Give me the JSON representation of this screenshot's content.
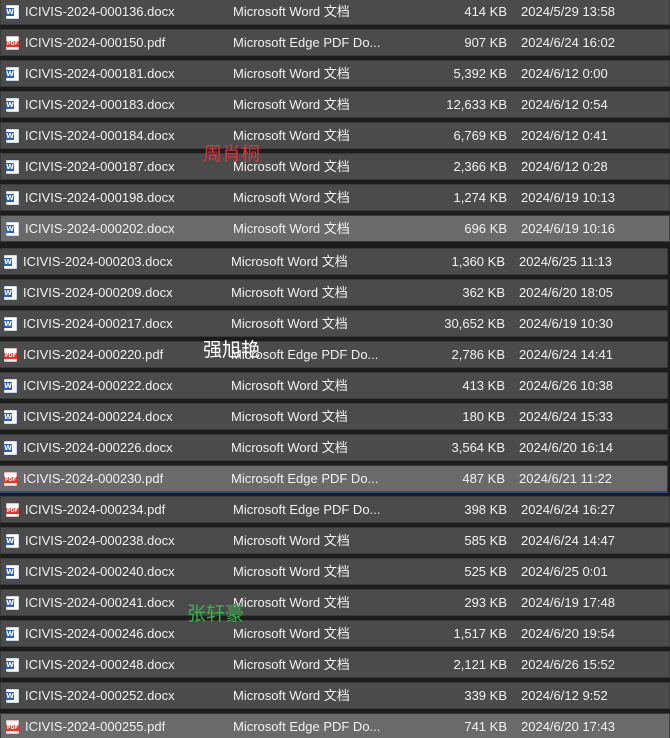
{
  "files": [
    {
      "name": "ICIVIS-2024-000136.docx",
      "type": "Microsoft Word 文档",
      "size": "414 KB",
      "date": "2024/5/29 13:58",
      "icon": "word-document-icon"
    },
    {
      "name": "ICIVIS-2024-000150.pdf",
      "type": "Microsoft Edge PDF Do...",
      "size": "907 KB",
      "date": "2024/6/24 16:02",
      "icon": "pdf-document-icon"
    },
    {
      "name": "ICIVIS-2024-000181.docx",
      "type": "Microsoft Word 文档",
      "size": "5,392 KB",
      "date": "2024/6/12 0:00",
      "icon": "word-document-icon"
    },
    {
      "name": "ICIVIS-2024-000183.docx",
      "type": "Microsoft Word 文档",
      "size": "12,633 KB",
      "date": "2024/6/12 0:54",
      "icon": "word-document-icon"
    },
    {
      "name": "ICIVIS-2024-000184.docx",
      "type": "Microsoft Word 文档",
      "size": "6,769 KB",
      "date": "2024/6/12 0:41",
      "icon": "word-document-icon"
    },
    {
      "name": "ICIVIS-2024-000187.docx",
      "type": "Microsoft Word 文档",
      "size": "2,366 KB",
      "date": "2024/6/12 0:28",
      "icon": "word-document-icon"
    },
    {
      "name": "ICIVIS-2024-000198.docx",
      "type": "Microsoft Word 文档",
      "size": "1,274 KB",
      "date": "2024/6/19 10:13",
      "icon": "word-document-icon"
    },
    {
      "name": "ICIVIS-2024-000202.docx",
      "type": "Microsoft Word 文档",
      "size": "696 KB",
      "date": "2024/6/19 10:16",
      "icon": "word-document-icon"
    },
    {
      "name": "ICIVIS-2024-000203.docx",
      "type": "Microsoft Word 文档",
      "size": "1,360 KB",
      "date": "2024/6/25 11:13",
      "icon": "word-document-icon"
    },
    {
      "name": "ICIVIS-2024-000209.docx",
      "type": "Microsoft Word 文档",
      "size": "362 KB",
      "date": "2024/6/20 18:05",
      "icon": "word-document-icon"
    },
    {
      "name": "ICIVIS-2024-000217.docx",
      "type": "Microsoft Word 文档",
      "size": "30,652 KB",
      "date": "2024/6/19 10:30",
      "icon": "word-document-icon"
    },
    {
      "name": "ICIVIS-2024-000220.pdf",
      "type": "Microsoft Edge PDF Do...",
      "size": "2,786 KB",
      "date": "2024/6/24 14:41",
      "icon": "pdf-document-icon"
    },
    {
      "name": "ICIVIS-2024-000222.docx",
      "type": "Microsoft Word 文档",
      "size": "413 KB",
      "date": "2024/6/26 10:38",
      "icon": "word-document-icon"
    },
    {
      "name": "ICIVIS-2024-000224.docx",
      "type": "Microsoft Word 文档",
      "size": "180 KB",
      "date": "2024/6/24 15:33",
      "icon": "word-document-icon"
    },
    {
      "name": "ICIVIS-2024-000226.docx",
      "type": "Microsoft Word 文档",
      "size": "3,564 KB",
      "date": "2024/6/20 16:14",
      "icon": "word-document-icon"
    },
    {
      "name": "ICIVIS-2024-000230.pdf",
      "type": "Microsoft Edge PDF Do...",
      "size": "487 KB",
      "date": "2024/6/21 11:22",
      "icon": "pdf-document-icon"
    },
    {
      "name": "ICIVIS-2024-000234.pdf",
      "type": "Microsoft Edge PDF Do...",
      "size": "398 KB",
      "date": "2024/6/24 16:27",
      "icon": "pdf-document-icon"
    },
    {
      "name": "ICIVIS-2024-000238.docx",
      "type": "Microsoft Word 文档",
      "size": "585 KB",
      "date": "2024/6/24 14:47",
      "icon": "word-document-icon"
    },
    {
      "name": "ICIVIS-2024-000240.docx",
      "type": "Microsoft Word 文档",
      "size": "525 KB",
      "date": "2024/6/25 0:01",
      "icon": "word-document-icon"
    },
    {
      "name": "ICIVIS-2024-000241.docx",
      "type": "Microsoft Word 文档",
      "size": "293 KB",
      "date": "2024/6/19 17:48",
      "icon": "word-document-icon"
    },
    {
      "name": "ICIVIS-2024-000246.docx",
      "type": "Microsoft Word 文档",
      "size": "1,517 KB",
      "date": "2024/6/20 19:54",
      "icon": "word-document-icon"
    },
    {
      "name": "ICIVIS-2024-000248.docx",
      "type": "Microsoft Word 文档",
      "size": "2,121 KB",
      "date": "2024/6/26 15:52",
      "icon": "word-document-icon"
    },
    {
      "name": "ICIVIS-2024-000252.docx",
      "type": "Microsoft Word 文档",
      "size": "339 KB",
      "date": "2024/6/12 9:52",
      "icon": "word-document-icon"
    },
    {
      "name": "ICIVIS-2024-000255.pdf",
      "type": "Microsoft Edge PDF Do...",
      "size": "741 KB",
      "date": "2024/6/20 17:43",
      "icon": "pdf-document-icon"
    }
  ],
  "annotations": [
    {
      "text": "周肖桐",
      "color": "#d9343a"
    },
    {
      "text": "强旭艳",
      "color": "#ffffff"
    },
    {
      "text": "张轩豪",
      "color": "#37b24d"
    }
  ]
}
